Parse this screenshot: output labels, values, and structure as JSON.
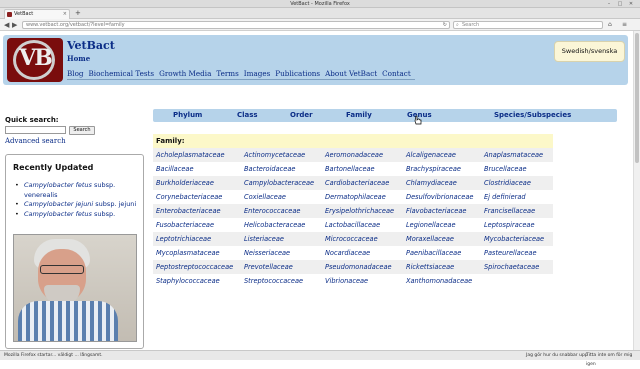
{
  "window": {
    "title": "VetBact - Mozilla Firefox"
  },
  "browser": {
    "tab_label": "VetBact",
    "tab_close": "×",
    "new_tab": "+",
    "url": "www.vetbact.org/vetbact/?level=family",
    "search_placeholder": "Search"
  },
  "site": {
    "name": "VetBact",
    "home": "Home",
    "logo_text": "VB",
    "lang_button": "Swedish/svenska",
    "nav": [
      "Blog",
      "Biochemical Tests",
      "Growth Media",
      "Terms",
      "Images",
      "Publications",
      "About VetBact",
      "Contact"
    ]
  },
  "sidebar": {
    "quick_search_label": "Quick search:",
    "search_value": "",
    "search_button": "Search",
    "advanced_search": "Advanced search",
    "recently_updated_title": "Recently Updated",
    "recent": [
      {
        "species": "Campylobacter fetus",
        "rest": " subsp. venerealis"
      },
      {
        "species": "Campylobacter jejuni",
        "rest": " subsp. jejuni"
      },
      {
        "species": "Campylobacter fetus",
        "rest": " subsp."
      }
    ]
  },
  "category_nav": [
    "Phylum",
    "Class",
    "Order",
    "Family",
    "Genus",
    "Species/Subspecies"
  ],
  "family": {
    "heading": "Family:",
    "rows": [
      [
        "Acholeplasmataceae",
        "Actinomycetaceae",
        "Aeromonadaceae",
        "Alcaligenaceae",
        "Anaplasmataceae"
      ],
      [
        "Bacillaceae",
        "Bacteroidaceae",
        "Bartonellaceae",
        "Brachyspiraceae",
        "Brucellaceae"
      ],
      [
        "Burkholderiaceae",
        "Campylobacteraceae",
        "Cardiobacteriaceae",
        "Chlamydiaceae",
        "Clostridiaceae"
      ],
      [
        "Corynebacteriaceae",
        "Coxiellaceae",
        "Dermatophilaceae",
        "Desulfovibrionaceae",
        "Ej definierad"
      ],
      [
        "Enterobacteriaceae",
        "Enterococcaceae",
        "Erysipelothrichaceae",
        "Flavobacteriaceae",
        "Francisellaceae"
      ],
      [
        "Fusobacteriaceae",
        "Helicobacteraceae",
        "Lactobacillaceae",
        "Legionellaceae",
        "Leptospiraceae"
      ],
      [
        "Leptotrichiaceae",
        "Listeriaceae",
        "Micrococcaceae",
        "Moraxellaceae",
        "Mycobacteriaceae"
      ],
      [
        "Mycoplasmataceae",
        "Neisseriaceae",
        "Nocardiaceae",
        "Paenibacillaceae",
        "Pasteurellaceae"
      ],
      [
        "Peptostreptococcaceae",
        "Prevotellaceae",
        "Pseudomonadaceae",
        "Rickettsiaceae",
        "Spirochaetaceae"
      ],
      [
        "Staphylococcaceae",
        "Streptococcaceae",
        "Vibrionaceae",
        "Xanthomonadaceae",
        ""
      ]
    ]
  },
  "statusbar": {
    "left": "Mozilla Firefox startar... väldigt ... långsamt.",
    "mid": "Jag gör hur du snabbar upp",
    "right": "Titta inte om för mig igen"
  }
}
